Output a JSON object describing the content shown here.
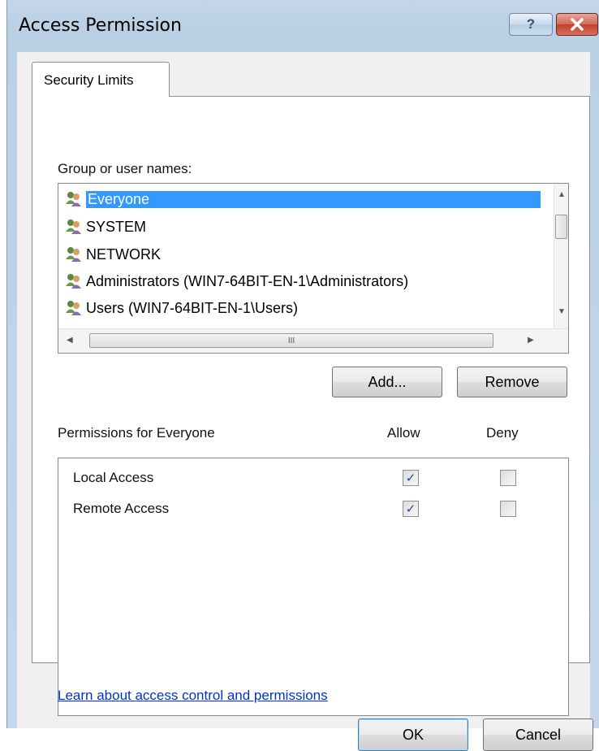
{
  "window": {
    "title": "Access Permission",
    "help_label": "?",
    "close_label": "✕"
  },
  "tabs": [
    {
      "label": "Security Limits",
      "selected": true
    }
  ],
  "groups": {
    "label": "Group or user names:",
    "items": [
      {
        "name": "Everyone",
        "selected": true
      },
      {
        "name": "SYSTEM",
        "selected": false
      },
      {
        "name": "NETWORK",
        "selected": false
      },
      {
        "name": "Administrators (WIN7-64BIT-EN-1\\Administrators)",
        "selected": false
      },
      {
        "name": "Users (WIN7-64BIT-EN-1\\Users)",
        "selected": false
      }
    ],
    "scroll_grip": "III"
  },
  "buttons": {
    "add": "Add...",
    "remove": "Remove",
    "ok": "OK",
    "cancel": "Cancel"
  },
  "permissions": {
    "label": "Permissions for Everyone",
    "allow_header": "Allow",
    "deny_header": "Deny",
    "rows": [
      {
        "name": "Local Access",
        "allow": true,
        "deny": false
      },
      {
        "name": "Remote Access",
        "allow": true,
        "deny": false
      }
    ]
  },
  "link": "Learn about access control and permissions",
  "colors": {
    "selection": "#3399ff",
    "link": "#0033cc"
  }
}
